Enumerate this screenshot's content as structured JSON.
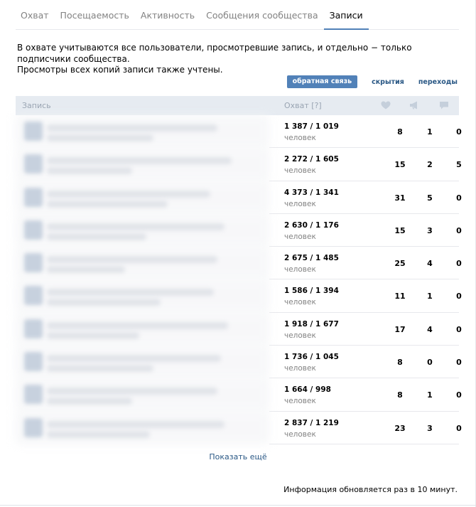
{
  "tabs": [
    {
      "label": "Охват",
      "active": false
    },
    {
      "label": "Посещаемость",
      "active": false
    },
    {
      "label": "Активность",
      "active": false
    },
    {
      "label": "Сообщения сообщества",
      "active": false
    },
    {
      "label": "Записи",
      "active": true
    }
  ],
  "info": {
    "line1": "В охвате учитываются все пользователи, просмотревшие запись, и отдельно − только подписчики сообщества.",
    "line2": "Просмотры всех копий записи также учтены."
  },
  "filters": [
    {
      "label": "обратная связь",
      "active": true
    },
    {
      "label": "скрытия",
      "active": false
    },
    {
      "label": "переходы",
      "active": false
    }
  ],
  "table": {
    "header_post": "Запись",
    "header_reach": "Охват [?]",
    "header_icons": [
      "heart-icon",
      "megaphone-icon",
      "comment-icon"
    ],
    "unit": "человек",
    "rows": [
      {
        "reach": "1 387 / 1 019",
        "likes": "8",
        "reposts": "1",
        "comments": "0"
      },
      {
        "reach": "2 272 / 1 605",
        "likes": "15",
        "reposts": "2",
        "comments": "5"
      },
      {
        "reach": "4 373 / 1 341",
        "likes": "31",
        "reposts": "5",
        "comments": "0"
      },
      {
        "reach": "2 630 / 1 176",
        "likes": "15",
        "reposts": "3",
        "comments": "0"
      },
      {
        "reach": "2 675 / 1 485",
        "likes": "25",
        "reposts": "4",
        "comments": "0"
      },
      {
        "reach": "1 586 / 1 394",
        "likes": "11",
        "reposts": "1",
        "comments": "0"
      },
      {
        "reach": "1 918 / 1 677",
        "likes": "17",
        "reposts": "4",
        "comments": "0"
      },
      {
        "reach": "1 736 / 1 045",
        "likes": "8",
        "reposts": "0",
        "comments": "0"
      },
      {
        "reach": "1 664 / 998",
        "likes": "8",
        "reposts": "1",
        "comments": "0"
      },
      {
        "reach": "2 837 / 1 219",
        "likes": "23",
        "reposts": "3",
        "comments": "0"
      }
    ]
  },
  "show_more": "Показать ещё",
  "footer_note": "Информация обновляется раз в 10 минут.",
  "colors": {
    "accent": "#5181b8",
    "link": "#2a5885",
    "header_bg": "#e6ebf1",
    "muted": "#828282"
  }
}
